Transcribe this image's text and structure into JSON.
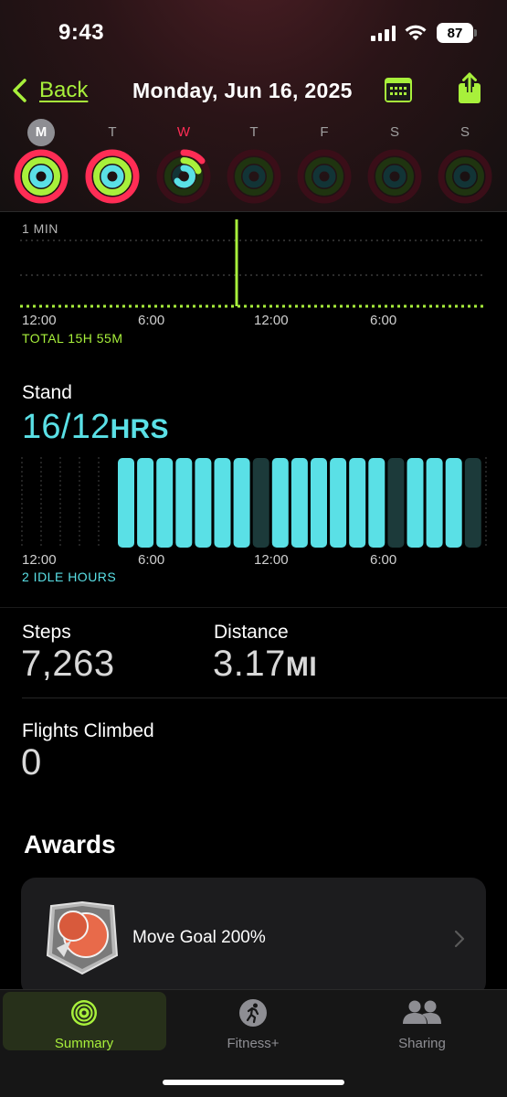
{
  "status": {
    "time": "9:43",
    "battery": "87"
  },
  "nav": {
    "back_label": "Back",
    "title": "Monday, Jun 16, 2025"
  },
  "week": {
    "days": [
      "M",
      "T",
      "W",
      "T",
      "F",
      "S",
      "S"
    ]
  },
  "exercise_chart": {
    "top_label": "1 MIN",
    "x_ticks": [
      "12:00",
      "6:00",
      "12:00",
      "6:00"
    ],
    "total_label": "TOTAL 15H 55M"
  },
  "stand": {
    "title": "Stand",
    "value": "16/12",
    "unit": "HRS",
    "x_ticks": [
      "12:00",
      "6:00",
      "12:00",
      "6:00"
    ],
    "idle_label": "2 IDLE HOURS",
    "hours": [
      0,
      0,
      0,
      0,
      0,
      1,
      1,
      1,
      1,
      1,
      1,
      1,
      0,
      1,
      1,
      1,
      1,
      1,
      1,
      0,
      1,
      1,
      1,
      0
    ],
    "colors": {
      "stood": "#5ae0e6",
      "idle": "#1c3a3a"
    }
  },
  "metrics": {
    "steps_label": "Steps",
    "steps_value": "7,263",
    "distance_label": "Distance",
    "distance_value": "3.17",
    "distance_unit": "MI",
    "flights_label": "Flights Climbed",
    "flights_value": "0"
  },
  "awards": {
    "title": "Awards",
    "items": [
      {
        "label": "Move Goal 200%",
        "icon": "move-goal-200-badge-icon"
      }
    ]
  },
  "tabbar": {
    "tabs": [
      {
        "label": "Summary",
        "icon": "summary-rings-icon",
        "active": true
      },
      {
        "label": "Fitness+",
        "icon": "fitness-plus-runner-icon",
        "active": false
      },
      {
        "label": "Sharing",
        "icon": "sharing-people-icon",
        "active": false
      }
    ]
  },
  "colors": {
    "accent": "#a8f03b",
    "move": "#ff2d55",
    "exercise": "#a8f03b",
    "stand": "#5ae0e6",
    "background": "#000000"
  }
}
